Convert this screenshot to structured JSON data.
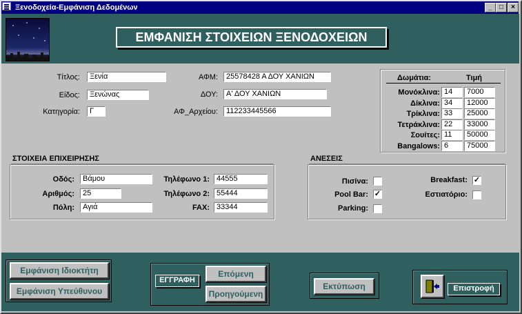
{
  "window": {
    "title": "Ξενοδοχεία-Εμφάνιση Δεδομένων",
    "minimize": "_",
    "maximize": "□",
    "close": "×"
  },
  "header": {
    "title": "ΕΜΦΑΝΙΣΗ ΣΤΟΙΧΕΙΩΝ ΞΕΝΟΔΟΧΕΙΩΝ"
  },
  "hotel": {
    "titlos_label": "Τίτλος:",
    "titlos": "Ξενία",
    "eidos_label": "Είδος:",
    "eidos": "Ξενώνας",
    "kategoria_label": "Κατηγορία:",
    "kategoria": "Γ",
    "afm_label": "ΑΦΜ:",
    "afm": "25578428 Α ΔΟΥ ΧΑΝΙΩΝ",
    "doy_label": "ΔΟΥ:",
    "doy": "Α' ΔΟΥ ΧΑΝΙΩΝ",
    "af_arxeiou_label": "ΑΦ_Αρχείου:",
    "af_arxeiou": "112233445566"
  },
  "rooms": {
    "col_type": "Δωμάτια:",
    "col_price": "Τιμή",
    "rows": [
      {
        "label": "Μονόκλινα:",
        "count": "14",
        "price": "7000"
      },
      {
        "label": "Δίκλινα:",
        "count": "34",
        "price": "12000"
      },
      {
        "label": "Τρίκλινα:",
        "count": "33",
        "price": "25000"
      },
      {
        "label": "Τετράκλινα:",
        "count": "22",
        "price": "33000"
      },
      {
        "label": "Σουίτες:",
        "count": "11",
        "price": "50000"
      },
      {
        "label": "Bangalows:",
        "count": "6",
        "price": "75000"
      }
    ]
  },
  "business": {
    "title": "ΣΤΟΙΧΕΙΑ ΕΠΙΧΕΙΡΗΣΗΣ",
    "odos_label": "Οδός:",
    "odos": "Βάμου",
    "arithmos_label": "Αριθμός:",
    "arithmos": "25",
    "poli_label": "Πόλη:",
    "poli": "Αγιά",
    "tel1_label": "Τηλέφωνο 1:",
    "tel1": "44555",
    "tel2_label": "Τηλέφωνο 2:",
    "tel2": "55444",
    "fax_label": "FAX:",
    "fax": "33344"
  },
  "amenities": {
    "title": "ΑΝΕΣΕΙΣ",
    "pisina_label": "Πισίνα:",
    "pisina": "",
    "poolbar_label": "Pool Bar:",
    "poolbar": "✓",
    "parking_label": "Parking:",
    "parking": "",
    "breakfast_label": "Breakfast:",
    "breakfast": "✓",
    "estiatorio_label": "Εστιατόριο:",
    "estiatorio": ""
  },
  "footer": {
    "owner_btn": "Εμφάνιση Ιδιοκτήτη",
    "manager_btn": "Εμφάνιση Υπεύθυνου",
    "record_label": "ΕΓΓΡΑΦΗ",
    "next_btn": "Επόμενη",
    "prev_btn": "Προηγούμενη",
    "print_btn": "Εκτύπωση",
    "return_label": "Επιστροφή"
  }
}
